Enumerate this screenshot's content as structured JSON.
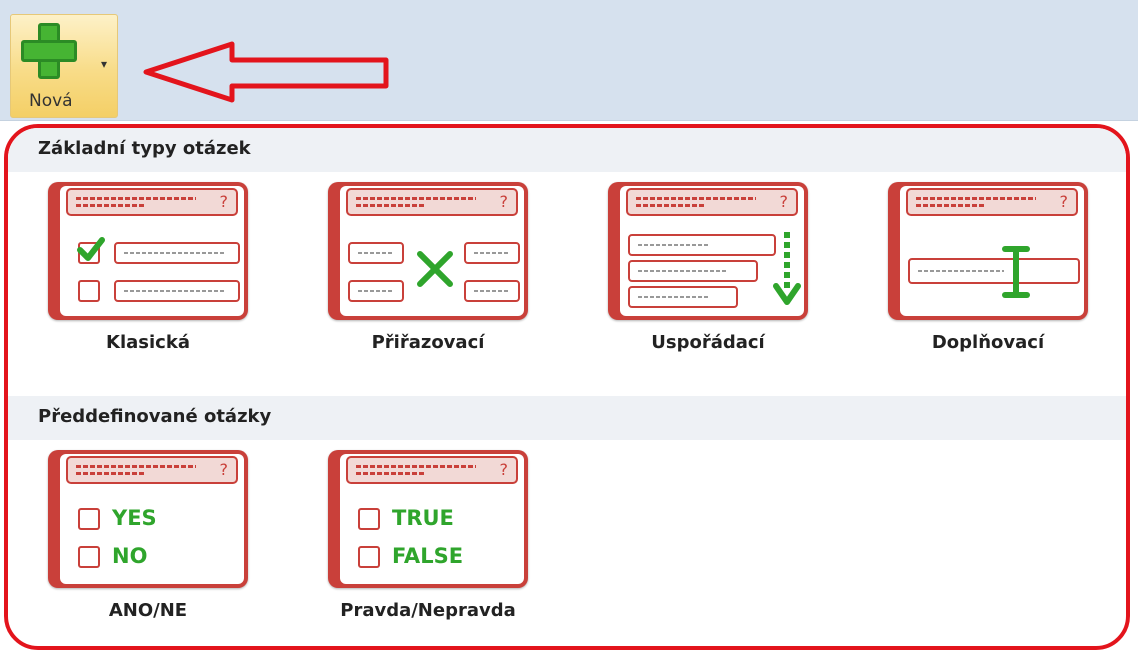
{
  "ribbon": {
    "new_button_label": "Nová",
    "new_button_icon": "plus-icon",
    "dropdown_icon": "caret-down-icon"
  },
  "sections": [
    {
      "title": "Základní typy otázek",
      "items": [
        {
          "label": "Klasická",
          "icon": "classic-question-icon"
        },
        {
          "label": "Přiřazovací",
          "icon": "matching-question-icon"
        },
        {
          "label": "Uspořádací",
          "icon": "ordering-question-icon"
        },
        {
          "label": "Doplňovací",
          "icon": "fill-in-question-icon"
        }
      ]
    },
    {
      "title": "Předdefinované otázky",
      "items": [
        {
          "label": "ANO/NE",
          "icon": "yes-no-question-icon",
          "options": [
            "YES",
            "NO"
          ]
        },
        {
          "label": "Pravda/Nepravda",
          "icon": "true-false-question-icon",
          "options": [
            "TRUE",
            "FALSE"
          ]
        }
      ]
    }
  ],
  "colors": {
    "accent": "#c9403a",
    "highlight": "#e3141c",
    "green": "#2fa52c"
  }
}
